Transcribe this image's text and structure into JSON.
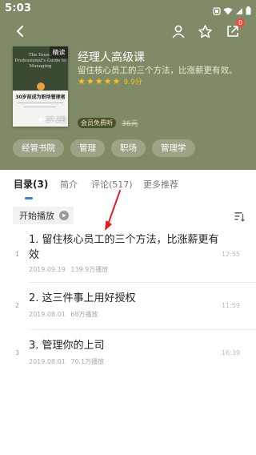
{
  "status": {
    "time": "5:03"
  },
  "book": {
    "title": "经理人高级课",
    "description": "留住核心员工的三个方法，比涨薪更有效。",
    "rating": "9.9分",
    "vip_label": "会员免费听",
    "original_price": "36元",
    "cover": {
      "tag": "精读",
      "title_en": "The Young Professional's Guide to Managing",
      "title_cn": "30岁前成为职场管理者",
      "plays": "27.2万"
    }
  },
  "nav": {
    "share_badge": "0"
  },
  "tags": [
    "经管书院",
    "管理",
    "职场",
    "管理学"
  ],
  "tabs": [
    {
      "label": "目录(3)",
      "active": true
    },
    {
      "label": "简介",
      "active": false
    },
    {
      "label": "评论(517)",
      "active": false
    },
    {
      "label": "更多推荐",
      "active": false
    }
  ],
  "play_all_label": "开始播放",
  "episodes": [
    {
      "index": "1",
      "title": "1. 留住核心员工的三个方法，比涨薪更有效",
      "date": "2019.09.19",
      "plays": "139.9万播放",
      "duration": "12:55"
    },
    {
      "index": "2",
      "title": "2. 这三件事上用好授权",
      "date": "2019.08.01",
      "plays": "68万播放",
      "duration": "11:59"
    },
    {
      "index": "3",
      "title": "3. 管理你的上司",
      "date": "2019.08.01",
      "plays": "70.1万播放",
      "duration": "16:39"
    }
  ],
  "colors": {
    "header_bg": "#7f8b66",
    "accent": "#3a7bf3",
    "star": "#ffc21c",
    "badge": "#f04a3a",
    "annotation": "#e02020"
  }
}
